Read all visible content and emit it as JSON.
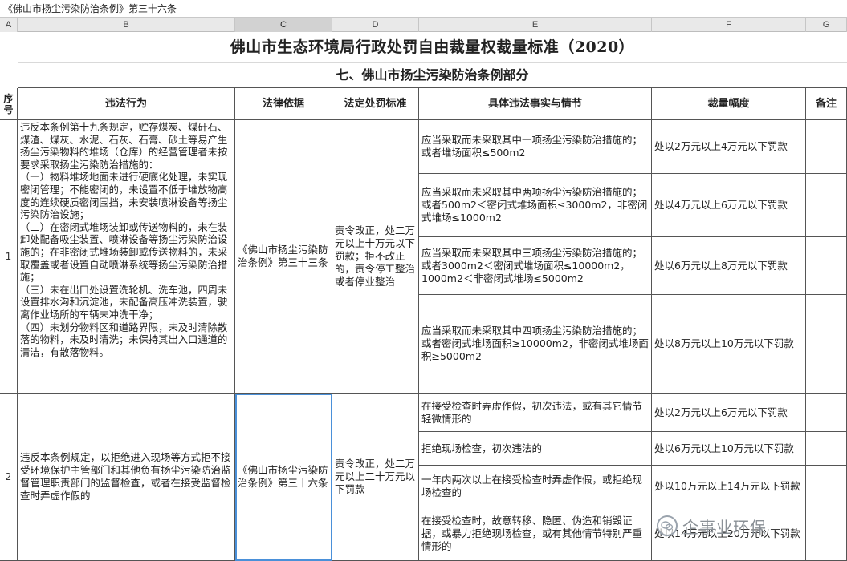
{
  "formula_bar": {
    "content": "《佛山市扬尘污染防治条例》第三十六条"
  },
  "column_headers": [
    "A",
    "B",
    "C",
    "D",
    "E",
    "F",
    "G"
  ],
  "selected_column": "C",
  "sheet": {
    "title": "佛山市生态环境局行政处罚自由裁量权裁量标准（2020）",
    "subtitle": "七、佛山市扬尘污染防治条例部分",
    "table_headers": {
      "seq": "序号",
      "violation": "违法行为",
      "legal_basis": "法律依据",
      "penalty_standard": "法定处罚标准",
      "facts": "具体违法事实与情节",
      "range": "裁量幅度",
      "remark": "备注"
    },
    "rows": [
      {
        "seq": "1",
        "violation": "违反本条例第十九条规定，贮存煤炭、煤矸石、煤渣、煤灰、水泥、石灰、石膏、砂土等易产生扬尘污染物料的堆场（仓库）的经营管理者未按要求采取扬尘污染防治措施的：\n（一）物料堆场地面未进行硬底化处理，未实现密闭管理；不能密闭的，未设置不低于堆放物高度的连续硬质密闭围挡，未安装喷淋设备等扬尘污染防治设施；\n（二）在密闭式堆场装卸或传送物料的，未在装卸处配备吸尘装置、喷淋设备等扬尘污染防治设施的；在非密闭式堆场装卸或传送物料的，未采取覆盖或者设置自动喷淋系统等扬尘污染防治措施；\n（三）未在出口处设置洗轮机、洗车池，四周未设置排水沟和沉淀池，未配备高压冲洗装置，驶离作业场所的车辆未冲洗干净；\n（四）未划分物料区和道路界限，未及时清除散落的物料，未及时清洗；未保持其出入口通道的清洁，有散落物料。",
        "legal_basis": "《佛山市扬尘污染防治条例》第三十三条",
        "penalty_standard": "责令改正，处二万元以上十万元以下罚款；拒不改正的，责令停工整治或者停业整治",
        "items": [
          {
            "facts": "应当采取而未采取其中一项扬尘污染防治措施的；或者堆场面积≤500m2",
            "range": "处以2万元以上4万元以下罚款"
          },
          {
            "facts": "应当采取而未采取其中两项扬尘污染防治措施的；或者500m2＜密闭式堆场面积≤3000m2，非密闭式堆场≤1000m2",
            "range": "处以4万元以上6万元以下罚款"
          },
          {
            "facts": "应当采取而未采取其中三项扬尘污染防治措施的；或者3000m2＜密闭式堆场面积≤10000m2，1000m2＜非密闭式堆场≤5000m2",
            "range": "处以6万元以上8万元以下罚款"
          },
          {
            "facts": "应当采取而未采取其中四项扬尘污染防治措施的；或者密闭式堆场面积≥10000m2，非密闭式堆场面积≥5000m2",
            "range": "处以8万元以上10万元以下罚款"
          }
        ]
      },
      {
        "seq": "2",
        "violation": "违反本条例规定，以拒绝进入现场等方式拒不接受环境保护主管部门和其他负有扬尘污染防治监督管理职责部门的监督检查，或者在接受监督检查时弄虚作假的",
        "legal_basis": "《佛山市扬尘污染防治条例》第三十六条",
        "penalty_standard": "责令改正，处二万元以上二十万元以下罚款",
        "items": [
          {
            "facts": "在接受检查时弄虚作假，初次违法，或有其它情节轻微情形的",
            "range": "处以2万元以上6万元以下罚款"
          },
          {
            "facts": "拒绝现场检查，初次违法的",
            "range": "处以6万元以上10万元以下罚款"
          },
          {
            "facts": "一年内两次以上在接受检查时弄虚作假，或拒绝现场检查的",
            "range": "处以10万元以上14万元以下罚款"
          },
          {
            "facts": "在接受检查时，故意转移、隐匿、伪造和销毁证据，或暴力拒绝现场检查，或有其他情节特别严重情形的",
            "range": "处以14万元以上20万元以下罚款"
          }
        ]
      }
    ]
  },
  "watermark": {
    "text": "企事业环保"
  }
}
